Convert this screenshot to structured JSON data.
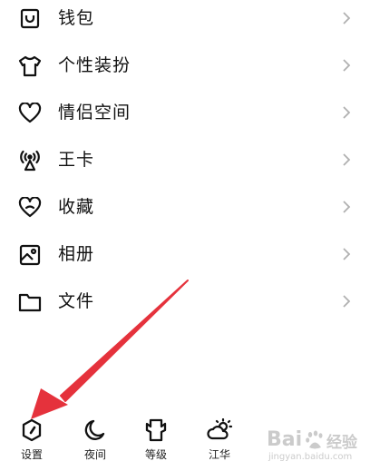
{
  "menu": {
    "items": [
      {
        "label": "钱包",
        "icon": "wallet-icon"
      },
      {
        "label": "个性装扮",
        "icon": "tshirt-icon"
      },
      {
        "label": "情侣空间",
        "icon": "heart-icon"
      },
      {
        "label": "王卡",
        "icon": "signal-tower-icon"
      },
      {
        "label": "收藏",
        "icon": "favorite-heart-icon"
      },
      {
        "label": "相册",
        "icon": "photo-album-icon"
      },
      {
        "label": "文件",
        "icon": "folder-icon"
      }
    ]
  },
  "bottom_bar": {
    "tabs": [
      {
        "label": "设置",
        "icon": "settings-hexagon-icon"
      },
      {
        "label": "夜间",
        "icon": "moon-icon"
      },
      {
        "label": "等级",
        "icon": "level-trophy-icon"
      },
      {
        "label": "江华",
        "icon": "weather-icon"
      }
    ]
  },
  "watermark": {
    "brand": "Bai",
    "brand_suffix": "经验",
    "domain": "jingyan.baidu.com"
  },
  "colors": {
    "text": "#111111",
    "chevron": "#b0b0b0",
    "arrow": "#e5323c"
  }
}
